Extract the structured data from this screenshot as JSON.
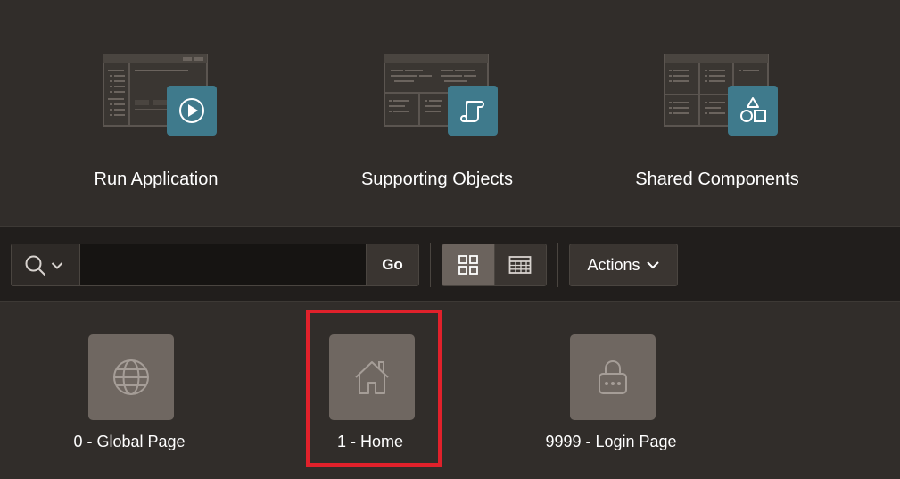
{
  "hero": {
    "cards": [
      {
        "label": "Run Application",
        "icon": "play-icon"
      },
      {
        "label": "Supporting Objects",
        "icon": "scroll-icon"
      },
      {
        "label": "Shared Components",
        "icon": "shapes-icon"
      }
    ],
    "badge_color": "#3f7a8c"
  },
  "toolbar": {
    "search_value": "",
    "go_label": "Go",
    "actions_label": "Actions",
    "view_selected": "icons"
  },
  "pages": [
    {
      "label": "0 - Global Page",
      "icon": "globe-icon"
    },
    {
      "label": "1 - Home",
      "icon": "home-icon"
    },
    {
      "label": "9999 - Login Page",
      "icon": "lock-icon"
    }
  ],
  "highlight_color": "#e0212b"
}
